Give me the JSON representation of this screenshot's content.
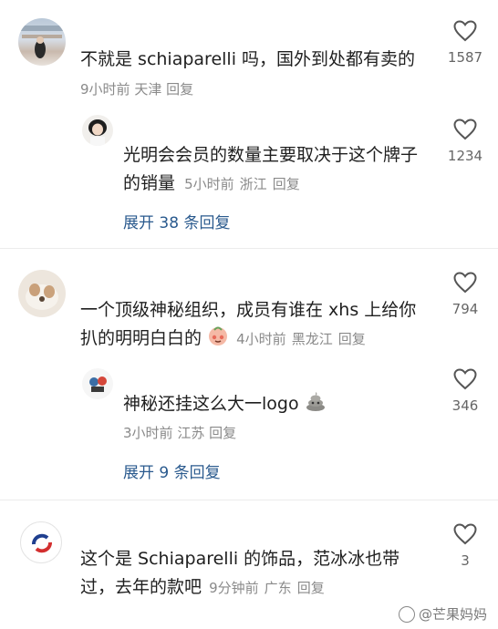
{
  "comments": [
    {
      "text": "不就是 schiaparelli 吗，国外到处都有卖的",
      "time": "9小时前",
      "location": "天津",
      "reply": "回复",
      "likes": "1587",
      "reply_thread": {
        "text_line1": "光明会会员的数量主要取决于这个牌子",
        "text_line2": "的销量",
        "time": "5小时前",
        "location": "浙江",
        "reply": "回复",
        "likes": "1234"
      },
      "expand": "展开 38 条回复"
    },
    {
      "text_line1": "一个顶级神秘组织，成员有谁在 xhs 上给你",
      "text_line2": "扒的明明白白的",
      "time": "4小时前",
      "location": "黑龙江",
      "reply": "回复",
      "likes": "794",
      "reply_thread": {
        "text": "神秘还挂这么大一logo",
        "time": "3小时前",
        "location": "江苏",
        "reply": "回复",
        "likes": "346"
      },
      "expand": "展开 9 条回复"
    },
    {
      "text_line1": "这个是 Schiaparelli 的饰品，范冰冰也带",
      "text_line2": "过，去年的款吧",
      "time": "9分钟前",
      "location": "广东",
      "reply": "回复",
      "likes": "3"
    }
  ],
  "watermark": "@芒果妈妈"
}
